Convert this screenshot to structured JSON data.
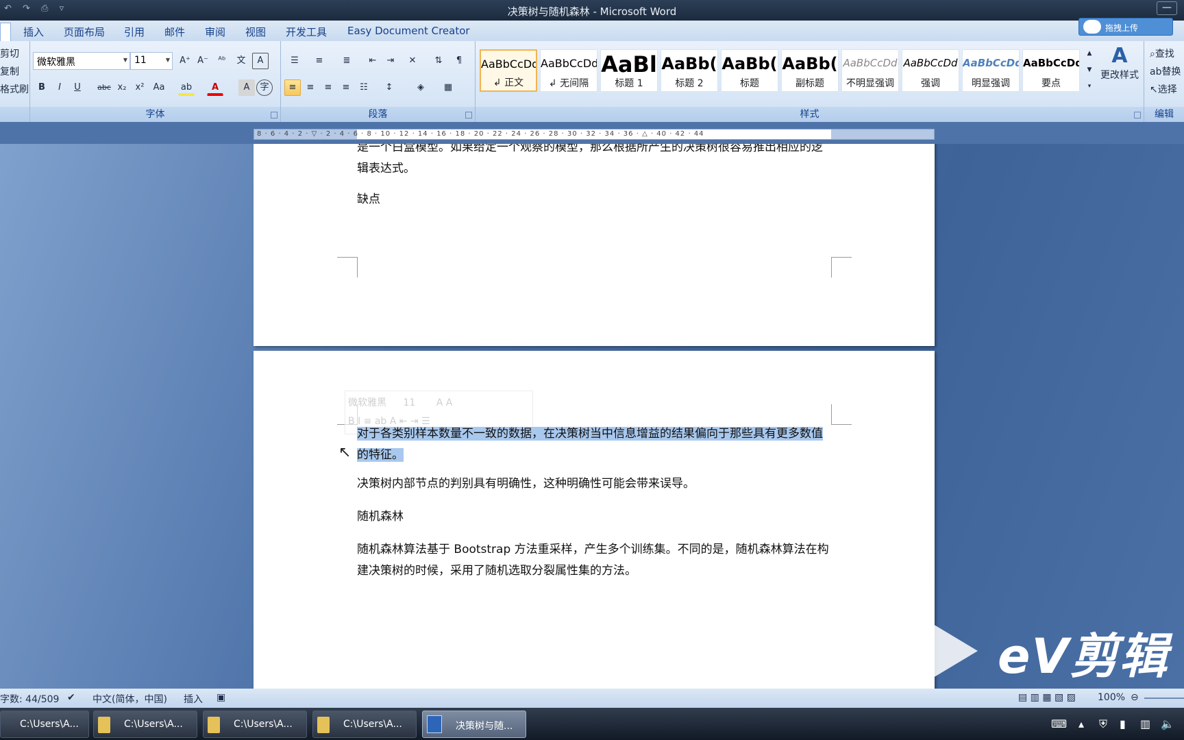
{
  "window": {
    "title": "决策树与随机森林 - Microsoft Word",
    "minimize": "—",
    "qat_icons": [
      "undo-icon",
      "redo-icon",
      "print-preview-icon",
      "customize-icon"
    ]
  },
  "tabs": [
    "插入",
    "页面布局",
    "引用",
    "邮件",
    "审阅",
    "视图",
    "开发工具",
    "Easy Document Creator"
  ],
  "upload_button": "拖拽上传",
  "clipboard": {
    "items": [
      "剪切",
      "复制",
      "格式刷"
    ]
  },
  "font": {
    "name": "微软雅黑",
    "size": "11",
    "label": "字体",
    "buttons": [
      "B",
      "I",
      "U",
      "abc",
      "x₂",
      "x²",
      "Aa",
      "A",
      "A"
    ]
  },
  "paragraph": {
    "label": "段落"
  },
  "styles": {
    "label": "样式",
    "items": [
      {
        "preview": "AaBbCcDd",
        "name": "↲ 正文"
      },
      {
        "preview": "AaBbCcDd",
        "name": "↲ 无间隔"
      },
      {
        "preview": "AaBl",
        "name": "标题 1"
      },
      {
        "preview": "AaBb(",
        "name": "标题 2"
      },
      {
        "preview": "AaBb(",
        "name": "标题"
      },
      {
        "preview": "AaBb(",
        "name": "副标题"
      },
      {
        "preview": "AaBbCcDd",
        "name": "不明显强调"
      },
      {
        "preview": "AaBbCcDd",
        "name": "强调"
      },
      {
        "preview": "AaBbCcDd",
        "name": "明显强调"
      },
      {
        "preview": "AaBbCcDd",
        "name": "要点"
      }
    ],
    "change": "更改样式"
  },
  "editing": {
    "label": "编辑",
    "items": [
      "查找",
      "替换",
      "选择"
    ]
  },
  "ruler": {
    "ticks": "8 · 6 · 4 · 2 · ▽ · 2 · 4 · 6 · 8 · 10 · 12 · 14 · 16 · 18 · 20 · 22 · 24 · 26 · 28 · 30 · 32 · 34 · 36 · △ · 40 · 42 · 44"
  },
  "document": {
    "page1": [
      "是一个白盒模型。如果给定一个观察的模型，那么根据所产生的决策树很容易推出相应的逻辑表达式。",
      "缺点"
    ],
    "page2": {
      "selected": "对于各类别样本数量不一致的数据，在决策树当中信息增益的结果偏向于那些具有更多数值的特征。",
      "p1": "决策树内部节点的判别具有明确性，这种明确性可能会带来误导。",
      "p2": "随机森林",
      "p3": "随机森林算法基于 Bootstrap 方法重采样，产生多个训练集。不同的是，随机森林算法在构建决策树的时候，采用了随机选取分裂属性集的方法。"
    }
  },
  "mini_toolbar": {
    "font": "微软雅黑",
    "size": "11"
  },
  "watermark": "eV剪辑",
  "status": {
    "words": "字数: 44/509",
    "language": "中文(简体，中国)",
    "mode": "插入",
    "zoom": "100%"
  },
  "taskbar": {
    "items": [
      "C:\\Users\\A...",
      "C:\\Users\\A...",
      "C:\\Users\\A...",
      "C:\\Users\\A...",
      "决策树与随..."
    ]
  }
}
